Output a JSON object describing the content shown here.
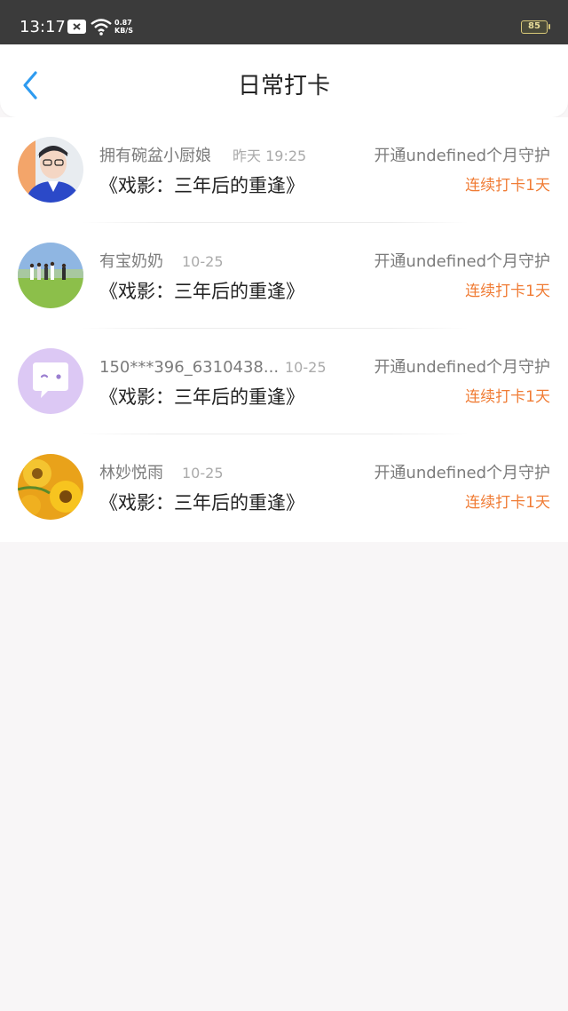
{
  "status_bar": {
    "time": "13:17",
    "net_speed_value": "0.87",
    "net_speed_unit": "KB/S",
    "battery": "85",
    "icons": [
      "notification-icon",
      "wifi-icon",
      "battery-icon"
    ]
  },
  "header": {
    "title": "日常打卡",
    "back_icon": "chevron-left-icon",
    "accent_color": "#2e9bf0"
  },
  "checkins": [
    {
      "user": "拥有碗盆小厨娘",
      "time": "昨天 19:25",
      "book": "《戏影：三年后的重逢》",
      "guard": "开通undefined个月守护",
      "streak": "连续打卡1天",
      "avatar": "avatar-boy-blue-jacket"
    },
    {
      "user": "有宝奶奶",
      "time": "10-25",
      "book": "《戏影：三年后的重逢》",
      "guard": "开通undefined个月守护",
      "streak": "连续打卡1天",
      "avatar": "avatar-people-on-field"
    },
    {
      "user": "150***396_6310438...",
      "time": "10-25",
      "book": "《戏影：三年后的重逢》",
      "guard": "开通undefined个月守护",
      "streak": "连续打卡1天",
      "avatar": "avatar-default-chat-bubble"
    },
    {
      "user": "林妙悦雨",
      "time": "10-25",
      "book": "《戏影：三年后的重逢》",
      "guard": "开通undefined个月守护",
      "streak": "连续打卡1天",
      "avatar": "avatar-sunflowers"
    }
  ],
  "colors": {
    "streak": "#f07c35",
    "status_bar": "#3b3b3b",
    "background": "#f8f6f7"
  }
}
